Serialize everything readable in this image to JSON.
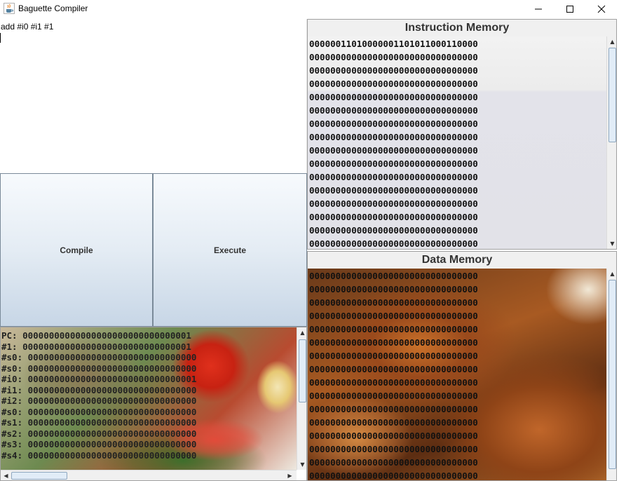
{
  "window": {
    "title": "Baguette Compiler",
    "icon": "java-coffee-icon"
  },
  "editor": {
    "source": "add #i0 #i1 #1"
  },
  "buttons": {
    "compile": "Compile",
    "execute": "Execute"
  },
  "registers": {
    "lines": [
      "PC: 00000000000000000000000000000001",
      "#1: 00000000000000000000000000000001",
      "#s0: 00000000000000000000000000000000",
      "#s0: 00000000000000000000000000000000",
      "#i0: 00000000000000000000000000000001",
      "#i1: 00000000000000000000000000000000",
      "#i2: 00000000000000000000000000000000",
      "#s0: 00000000000000000000000000000000",
      "#s1: 00000000000000000000000000000000",
      "#s2: 00000000000000000000000000000000",
      "#s3: 00000000000000000000000000000000",
      "#s4: 00000000000000000000000000000000"
    ]
  },
  "instruction_memory": {
    "title": "Instruction Memory",
    "words": [
      "00000011010000001101011000110000",
      "00000000000000000000000000000000",
      "00000000000000000000000000000000",
      "00000000000000000000000000000000",
      "00000000000000000000000000000000",
      "00000000000000000000000000000000",
      "00000000000000000000000000000000",
      "00000000000000000000000000000000",
      "00000000000000000000000000000000",
      "00000000000000000000000000000000",
      "00000000000000000000000000000000",
      "00000000000000000000000000000000",
      "00000000000000000000000000000000",
      "00000000000000000000000000000000",
      "00000000000000000000000000000000",
      "00000000000000000000000000000000"
    ]
  },
  "data_memory": {
    "title": "Data Memory",
    "words": [
      "00000000000000000000000000000000",
      "00000000000000000000000000000000",
      "00000000000000000000000000000000",
      "00000000000000000000000000000000",
      "00000000000000000000000000000000",
      "00000000000000000000000000000000",
      "00000000000000000000000000000000",
      "00000000000000000000000000000000",
      "00000000000000000000000000000000",
      "00000000000000000000000000000000",
      "00000000000000000000000000000000",
      "00000000000000000000000000000000",
      "00000000000000000000000000000000",
      "00000000000000000000000000000000",
      "00000000000000000000000000000000",
      "00000000000000000000000000000000"
    ]
  }
}
